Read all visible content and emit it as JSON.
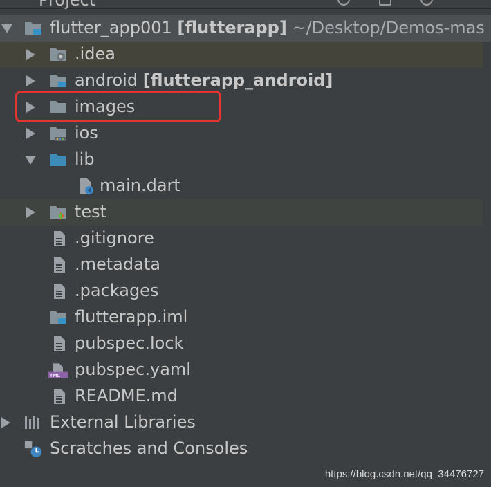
{
  "panel": {
    "title": "Project"
  },
  "root": {
    "name": "flutter_app001",
    "module": "[flutterapp]",
    "path": "~/Desktop/Demos-mas"
  },
  "items": [
    {
      "label": ".idea",
      "icon": "idea-folder-icon",
      "expanded": false
    },
    {
      "label": "android",
      "module": "[flutterapp_android]",
      "icon": "android-module-folder-icon",
      "expanded": false
    },
    {
      "label": "images",
      "icon": "folder-icon",
      "expanded": false
    },
    {
      "label": "ios",
      "icon": "ios-folder-icon",
      "expanded": false
    },
    {
      "label": "lib",
      "icon": "source-folder-icon",
      "expanded": true
    },
    {
      "label": "main.dart",
      "icon": "dart-file-icon"
    },
    {
      "label": "test",
      "icon": "test-folder-icon",
      "expanded": false
    },
    {
      "label": ".gitignore",
      "icon": "text-file-icon"
    },
    {
      "label": ".metadata",
      "icon": "text-file-icon"
    },
    {
      "label": ".packages",
      "icon": "text-file-icon"
    },
    {
      "label": "flutterapp.iml",
      "icon": "module-file-icon"
    },
    {
      "label": "pubspec.lock",
      "icon": "text-file-icon"
    },
    {
      "label": "pubspec.yaml",
      "icon": "yaml-file-icon"
    },
    {
      "label": "README.md",
      "icon": "text-file-icon"
    }
  ],
  "external_libraries": {
    "label": "External Libraries",
    "icon": "libraries-icon"
  },
  "scratches": {
    "label": "Scratches and Consoles",
    "icon": "scratches-icon"
  },
  "watermark": "https://blog.csdn.net/qq_34476727",
  "colors": {
    "highlight_box": "#e8332e",
    "background": "#3c3f41",
    "selected_row": "#4c5052"
  }
}
